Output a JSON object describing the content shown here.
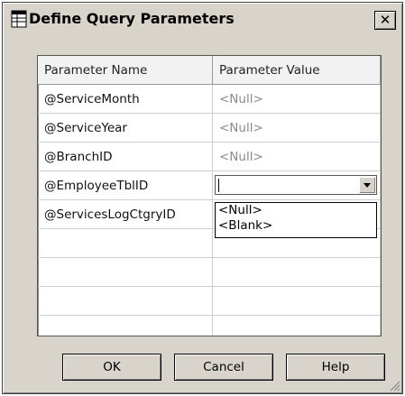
{
  "dialog": {
    "title": "Define Query Parameters",
    "close_symbol": "✕"
  },
  "grid": {
    "columns": [
      "Parameter Name",
      "Parameter Value"
    ],
    "rows": [
      {
        "name": "@ServiceMonth",
        "value": "<Null>"
      },
      {
        "name": "@ServiceYear",
        "value": "<Null>"
      },
      {
        "name": "@BranchID",
        "value": "<Null>"
      },
      {
        "name": "@EmployeeTblID",
        "value": ""
      },
      {
        "name": "@ServicesLogCtgryID",
        "value": ""
      }
    ],
    "dropdown_options": [
      "<Null>",
      "<Blank>"
    ]
  },
  "buttons": {
    "ok": "OK",
    "cancel": "Cancel",
    "help": "Help"
  },
  "icons": {
    "title": "grid-window-icon",
    "close": "close-icon",
    "dropdown": "chevron-down-icon",
    "resize": "resize-grip-icon"
  }
}
